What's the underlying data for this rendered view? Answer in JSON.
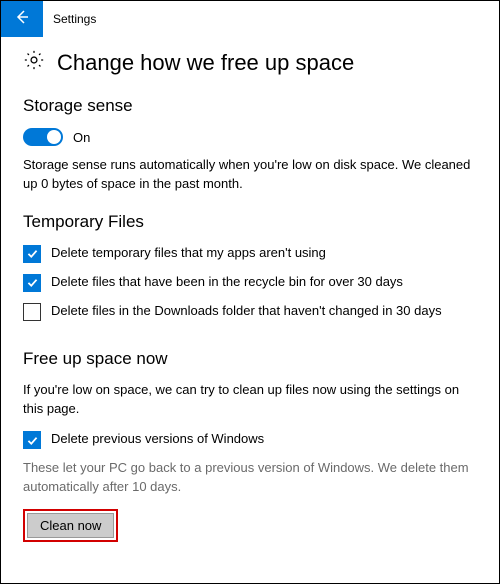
{
  "titlebar": {
    "label": "Settings"
  },
  "header": {
    "title": "Change how we free up space"
  },
  "storage_sense": {
    "section_title": "Storage sense",
    "toggle_state": "On",
    "description": "Storage sense runs automatically when you're low on disk space. We cleaned up 0 bytes of space in the past month."
  },
  "temp_files": {
    "section_title": "Temporary Files",
    "items": [
      {
        "label": "Delete temporary files that my apps aren't using",
        "checked": true
      },
      {
        "label": "Delete files that have been in the recycle bin for over 30 days",
        "checked": true
      },
      {
        "label": "Delete files in the Downloads folder that haven't changed in 30 days",
        "checked": false
      }
    ]
  },
  "free_up": {
    "section_title": "Free up space now",
    "intro": "If you're low on space, we can try to clean up files now using the settings on this page.",
    "prev_versions_label": "Delete previous versions of Windows",
    "prev_versions_note": "These let your PC go back to a previous version of Windows. We delete them automatically after 10 days.",
    "button_label": "Clean now"
  }
}
